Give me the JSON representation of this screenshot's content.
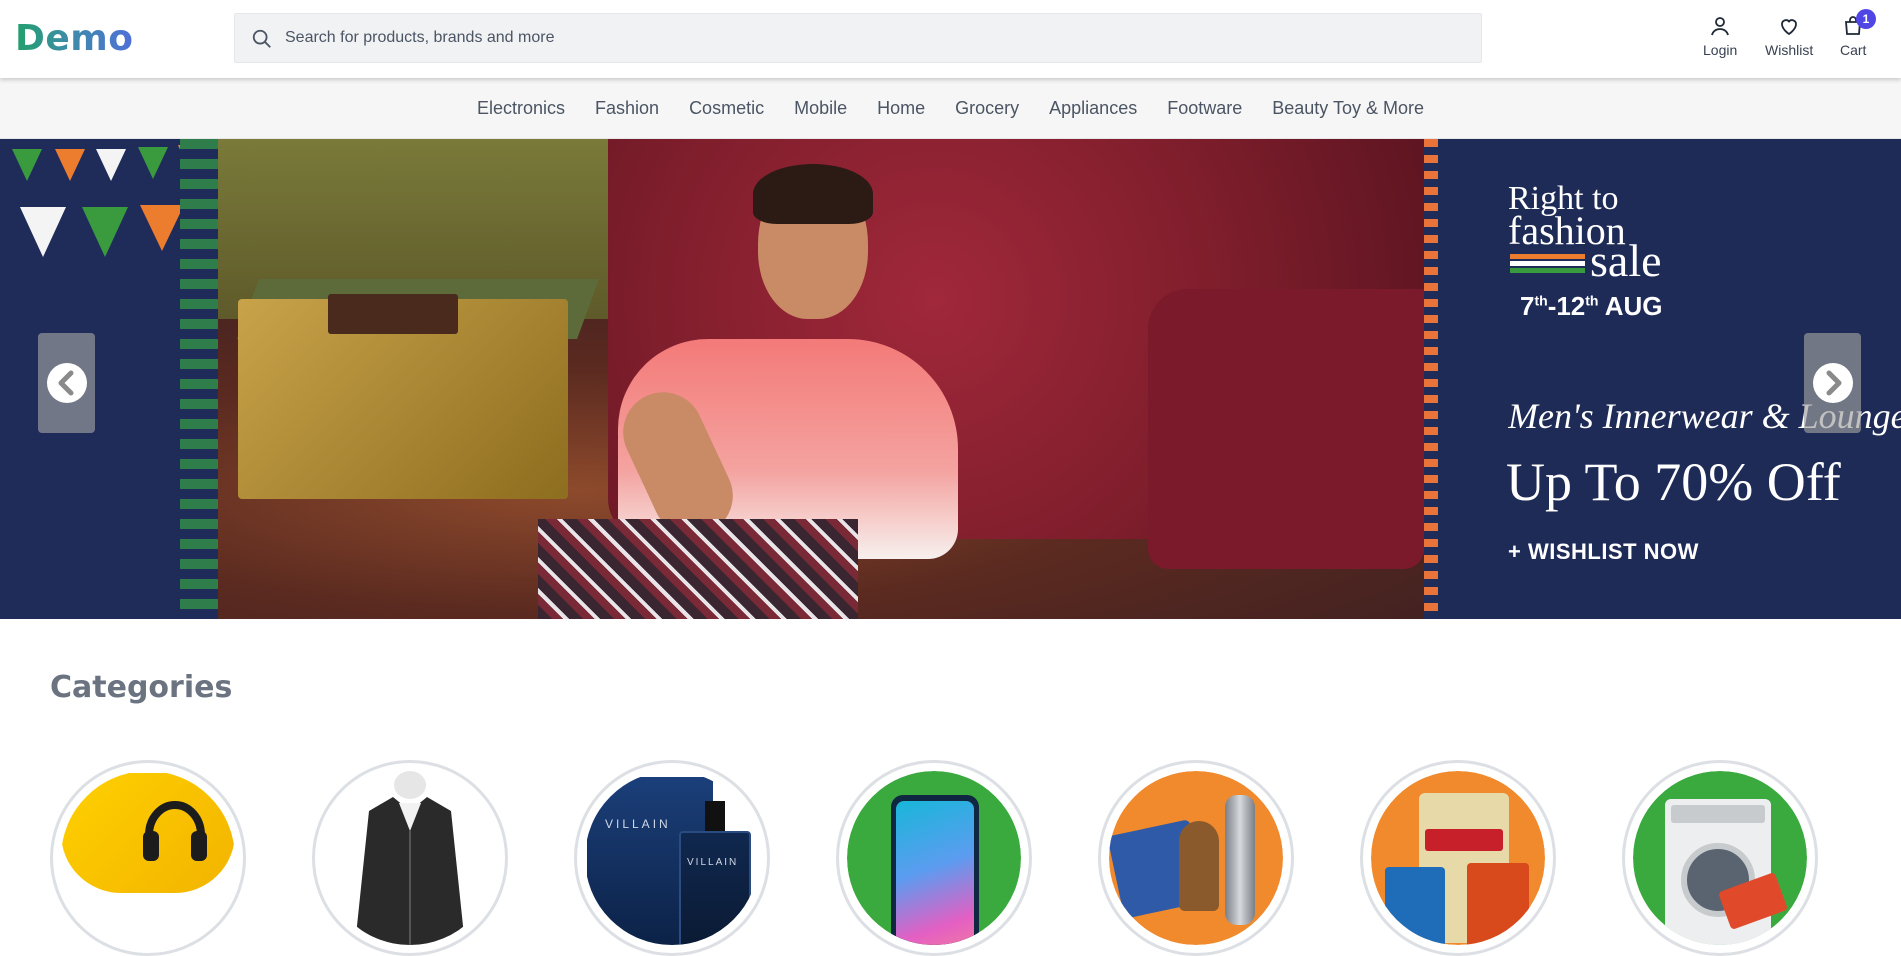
{
  "header": {
    "logo": "Demo",
    "search_placeholder": "Search for products, brands and more",
    "actions": {
      "login": "Login",
      "wishlist": "Wishlist",
      "cart": "Cart",
      "cart_count": "1"
    },
    "icons": {
      "search": "search-icon",
      "login": "user-icon",
      "wishlist": "heart-icon",
      "cart": "shopping-bag-icon"
    }
  },
  "nav": {
    "categories": [
      "Electronics",
      "Fashion",
      "Cosmetic",
      "Mobile",
      "Home",
      "Grocery",
      "Appliances",
      "Footware",
      "Beauty Toy & More"
    ]
  },
  "banner": {
    "line1": "Right to",
    "line2": "fashion",
    "line3": "sale",
    "date_day1": "7",
    "date_sup1": "th",
    "date_mid": "-12",
    "date_sup2": "th",
    "date_month": " AUG",
    "subtitle": "Men's Innerwear & Loungewear",
    "offer": "Up To 70% Off",
    "cta": "+ WISHLIST NOW",
    "icons": {
      "prev": "chevron-left-icon",
      "next": "chevron-right-icon"
    }
  },
  "categories_section": {
    "heading": "Categories",
    "items": [
      {
        "name": "headphones",
        "bg": "#f5c400"
      },
      {
        "name": "leather-jacket",
        "bg": "#ffffff"
      },
      {
        "name": "perfume",
        "bg": "#0f2a5a"
      },
      {
        "name": "smartphone",
        "bg": "#3aaa3f"
      },
      {
        "name": "home-decor",
        "bg": "#f08a2c"
      },
      {
        "name": "grocery",
        "bg": "#f08a2c"
      },
      {
        "name": "washing-machine",
        "bg": "#3aaa3f"
      }
    ]
  },
  "colors": {
    "accent": "#4f46e5",
    "banner_navy": "#1e2b57",
    "heading_gray": "#6b7280"
  }
}
